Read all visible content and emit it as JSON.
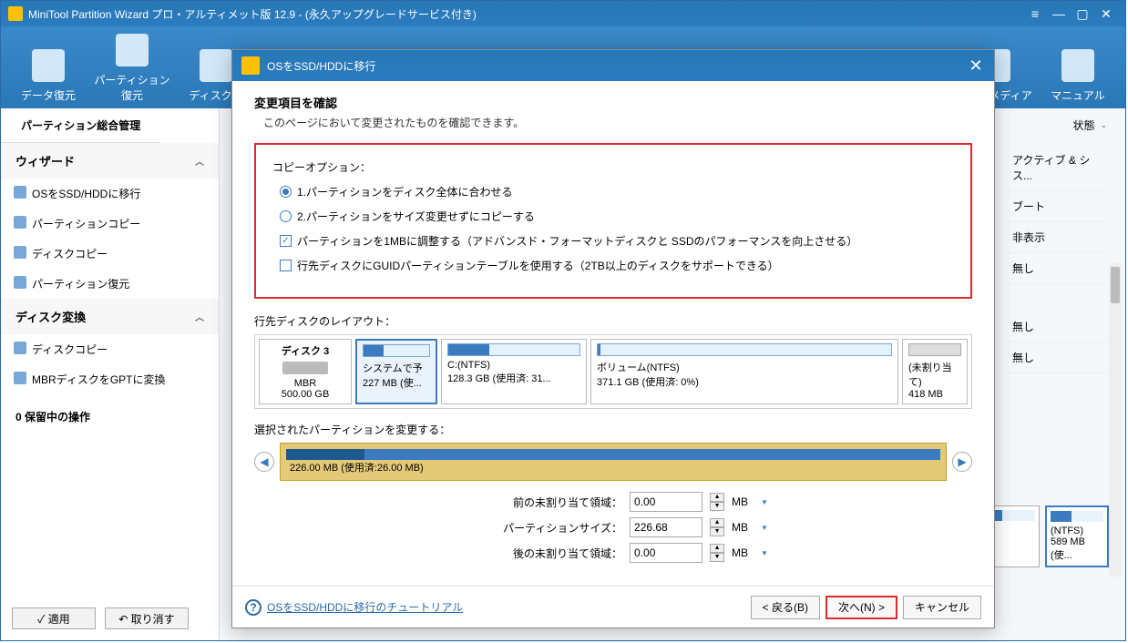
{
  "window": {
    "title": "MiniTool Partition Wizard プロ・アルティメット版 12.9 - (永久アップグレードサービス付き)"
  },
  "toolbar": {
    "items": [
      "データ復元",
      "パーティション復元",
      "ディスクベ",
      "",
      "",
      "タブルメディア",
      "マニュアル"
    ]
  },
  "sidebar": {
    "tab": "パーティション総合管理",
    "group1": "ウィザード",
    "items1": [
      "OSをSSD/HDDに移行",
      "パーティションコピー",
      "ディスクコピー",
      "パーティション復元"
    ],
    "group2": "ディスク変換",
    "items2": [
      "ディスクコピー",
      "MBRディスクをGPTに変換"
    ],
    "pending": "0 保留中の操作",
    "apply": "✓ 適用",
    "undo": "↶ 取り消す"
  },
  "content": {
    "stateHeader": "状態",
    "states": [
      "アクティブ & シス...",
      "ブート",
      "非表示",
      "無し",
      "無し",
      "無し"
    ]
  },
  "thumb": {
    "l1": "(NTFS)",
    "l2": "589 MB (使..."
  },
  "modal": {
    "title": "OSをSSD/HDDに移行",
    "heading": "変更項目を確認",
    "sub": "このページにおいて変更されたものを確認できます。",
    "optionsLabel": "コピーオプション：",
    "opt1": "1.パーティションをディスク全体に合わせる",
    "opt2": "2.パーティションをサイズ変更せずにコピーする",
    "chk1": "パーティションを1MBに調整する（アドバンスド・フォーマットディスクと SSDのパフォーマンスを向上させる）",
    "chk2": "行先ディスクにGUIDパーティションテーブルを使用する（2TB以上のディスクをサポートできる）",
    "layoutLabel": "行先ディスクのレイアウト：",
    "disk": {
      "name": "ディスク 3",
      "type": "MBR",
      "size": "500.00 GB",
      "p1a": "システムで予",
      "p1b": "227 MB (使...",
      "p2a": "C:(NTFS)",
      "p2b": "128.3 GB (使用済: 31...",
      "p3a": "ボリューム(NTFS)",
      "p3b": "371.1 GB (使用済: 0%)",
      "p4a": "(未割り当て)",
      "p4b": "418 MB"
    },
    "editLabel": "選択されたパーティションを変更する：",
    "editInfo": "226.00 MB (使用済:26.00 MB)",
    "form": {
      "beforeLabel": "前の未割り当て領域：",
      "beforeVal": "0.00",
      "sizeLabel": "パーティションサイズ：",
      "sizeVal": "226.68",
      "afterLabel": "後の未割り当て領域：",
      "afterVal": "0.00",
      "unit": "MB"
    },
    "helpLink": "OSをSSD/HDDに移行のチュートリアル",
    "back": "< 戻る(B)",
    "next": "次へ(N) >",
    "cancel": "キャンセル"
  }
}
